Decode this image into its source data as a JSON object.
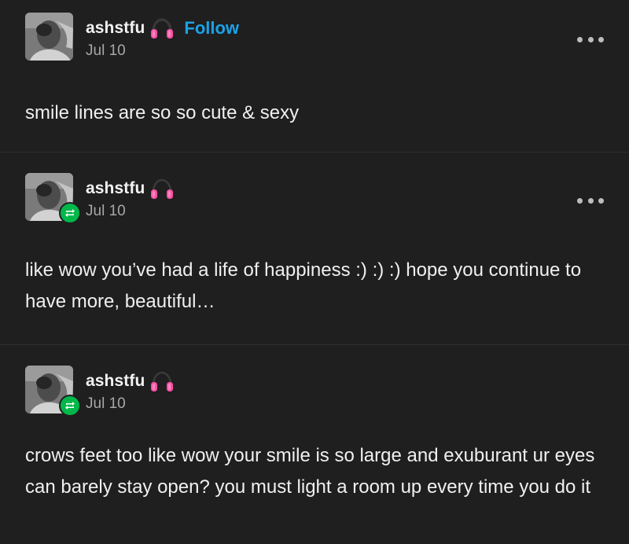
{
  "posts": [
    {
      "username": "ashstfu",
      "follow_label": "Follow",
      "date": "Jul 10",
      "text": "smile lines are so so cute & sexy",
      "reblogged": false
    },
    {
      "username": "ashstfu",
      "date": "Jul 10",
      "text": "like wow you’ve had a life of happiness :) :) :) hope you continue to have more, beautiful…",
      "reblogged": true
    },
    {
      "username": "ashstfu",
      "date": "Jul 10",
      "text": "crows feet too like wow your smile is so large and exuburant ur eyes can barely stay open? you must light a room up every time you do it",
      "reblogged": true
    }
  ],
  "icons": {
    "name_badge": "headphones-icon",
    "reblog": "reblog-icon",
    "menu": "more-options-icon"
  },
  "colors": {
    "background": "#1f1f1f",
    "follow": "#1aa3e8",
    "reblog_badge": "#00b84a",
    "headphones": "#ff4fa3"
  }
}
